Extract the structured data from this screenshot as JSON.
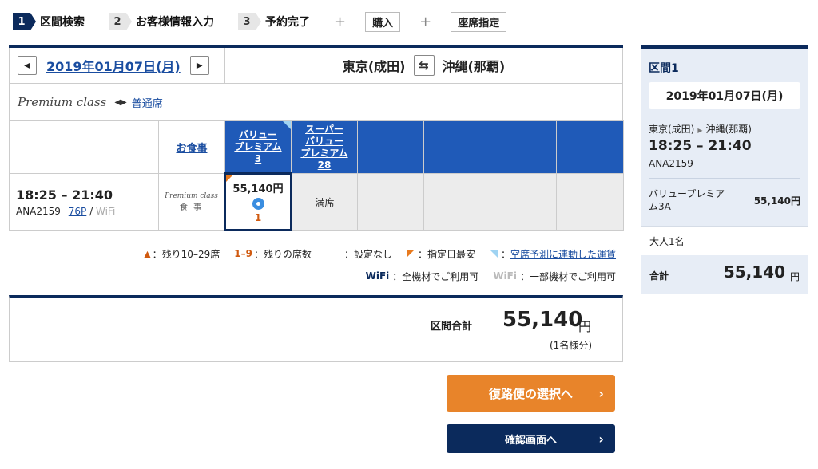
{
  "steps": {
    "s1_num": "1",
    "s1_label": "区間検索",
    "s2_num": "2",
    "s2_label": "お客様情報入力",
    "s3_num": "3",
    "s3_label": "予約完了",
    "plus": "+",
    "purchase": "購入",
    "seat": "座席指定"
  },
  "datebar": {
    "date": "2019年01月07日(月)",
    "prev": "◀",
    "next": "▶",
    "from": "東京(成田)",
    "to": "沖縄(那覇)",
    "swap": "⇆"
  },
  "classrow": {
    "logo": "Premium class",
    "arrows": "◀▶",
    "link": "普通席"
  },
  "table": {
    "meal_header": "お食事",
    "fare1_l1": "バリュー",
    "fare1_l2": "プレミアム",
    "fare1_count": "3",
    "fare2_l1": "スーパー",
    "fare2_l2": "バリュー",
    "fare2_l3": "プレミアム",
    "fare2_count": "28",
    "flight": {
      "time": "18:25 – 21:40",
      "number": "ANA2159",
      "equipment": "76P",
      "sep": "/",
      "wifi": "WiFi",
      "meal_logo": "Premium class",
      "meal_word": "食 事",
      "price": "55,140円",
      "seats_left": "1",
      "full": "満席"
    }
  },
  "legend": {
    "tri": "▲",
    "l1": "：残り10–29席",
    "range": "1–9",
    "l2": "：残りの席数",
    "dash": "–––",
    "l3": "：設定なし",
    "l4": "：指定日最安",
    "l5_prefix": "：",
    "l5_link": "空席予測に連動した運賃",
    "wifi_all": "WiFi",
    "l6": "：全機材でご利用可",
    "wifi_part": "WiFi",
    "l7": "：一部機材でご利用可"
  },
  "total": {
    "label": "区間合計",
    "amount": "55,140",
    "unit": "円",
    "note": "(1名様分)"
  },
  "buttons": {
    "return": "復路便の選択へ",
    "confirm": "確認画面へ",
    "chev": "›"
  },
  "summary": {
    "title": "区間1",
    "date": "2019年01月07日(月)",
    "from": "東京(成田)",
    "tri": "▶",
    "to": "沖縄(那覇)",
    "time": "18:25 – 21:40",
    "flight": "ANA2159",
    "fare_name": "バリュープレミアム3A",
    "fare_price": "55,140円",
    "pax": "大人1名",
    "total_label": "合計",
    "total_amount": "55,140",
    "total_unit": "円"
  },
  "colors": {
    "navy": "#0b2a5c",
    "fare_blue": "#1f5ab8",
    "orange": "#e8842a",
    "link": "#1a4da0",
    "side_bg": "#e7edf6"
  }
}
